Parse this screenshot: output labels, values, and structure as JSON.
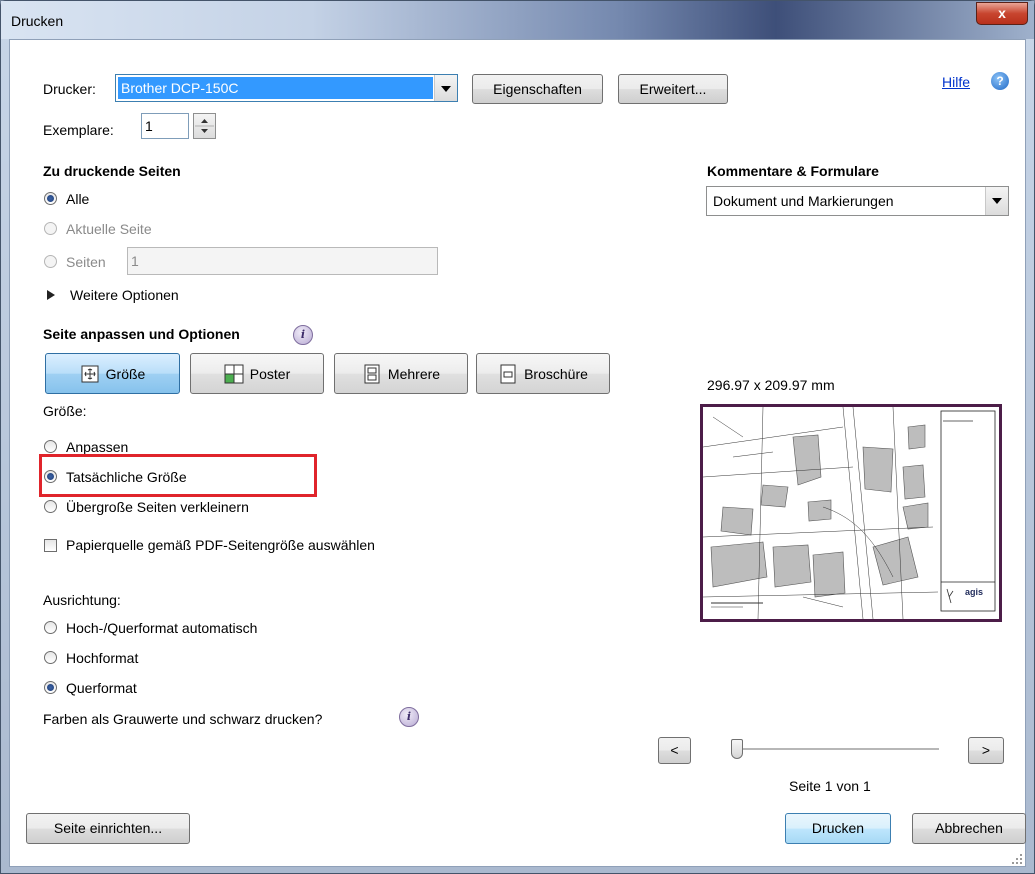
{
  "window": {
    "title": "Drucken",
    "close_label": "x"
  },
  "help": {
    "label": "Hilfe"
  },
  "printer": {
    "label": "Drucker:",
    "value": "Brother DCP-150C",
    "properties_button": "Eigenschaften",
    "advanced_button": "Erweitert..."
  },
  "copies": {
    "label": "Exemplare:",
    "value": "1"
  },
  "pages": {
    "heading": "Zu druckende Seiten",
    "all": "Alle",
    "current": "Aktuelle Seite",
    "range": "Seiten",
    "range_value": "1",
    "more_options": "Weitere Optionen"
  },
  "comments": {
    "heading": "Kommentare & Formulare",
    "value": "Dokument und Markierungen"
  },
  "fit": {
    "heading": "Seite anpassen und Optionen",
    "tiles": {
      "size": "Größe",
      "poster": "Poster",
      "multiple": "Mehrere",
      "booklet": "Broschüre"
    },
    "size_label": "Größe:",
    "fit": "Anpassen",
    "actual": "Tatsächliche Größe",
    "shrink": "Übergroße Seiten verkleinern",
    "paper_source": "Papierquelle gemäß PDF-Seitengröße auswählen"
  },
  "orientation": {
    "label": "Ausrichtung:",
    "auto": "Hoch-/Querformat automatisch",
    "portrait": "Hochformat",
    "landscape": "Querformat"
  },
  "grayscale": {
    "label": "Farben als Grauwerte und schwarz drucken?"
  },
  "preview": {
    "dimensions": "296.97 x 209.97 mm",
    "page_indicator": "Seite 1 von 1",
    "prev": "<",
    "next": ">",
    "logo_text": "agis"
  },
  "footer": {
    "page_setup": "Seite einrichten...",
    "print": "Drucken",
    "cancel": "Abbrechen"
  },
  "colors": {
    "highlight": "#e0242b",
    "preview_border": "#4c1d48",
    "link": "#0033cc"
  }
}
